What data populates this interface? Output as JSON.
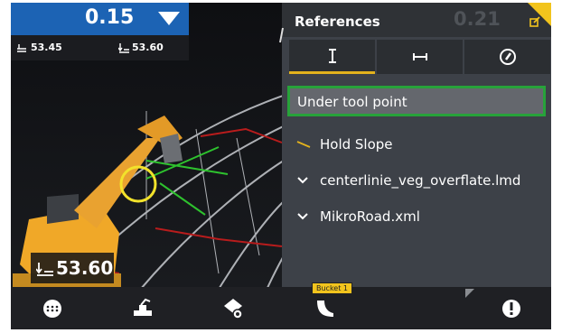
{
  "topbar": {
    "value": "0.15"
  },
  "subbar": {
    "left_value": "53.45",
    "right_value": "53.60"
  },
  "readout": {
    "value": "53.60"
  },
  "panel": {
    "title": "References",
    "ghost_value": "0.21",
    "selected_item": "Under tool point",
    "items": [
      {
        "label": "Hold Slope",
        "icon": "slope-line-icon"
      },
      {
        "label": "centerlinie_veg_overflate.lmd",
        "icon": "chevron-down-icon"
      },
      {
        "label": "MikroRoad.xml",
        "icon": "chevron-down-icon"
      }
    ]
  },
  "bottombar": {
    "bucket_label": "Bucket 1"
  },
  "colors": {
    "accent_blue": "#1c63b4",
    "accent_yellow": "#f2c41d",
    "select_green": "#27a23a",
    "panel_bg": "#3d4148"
  }
}
